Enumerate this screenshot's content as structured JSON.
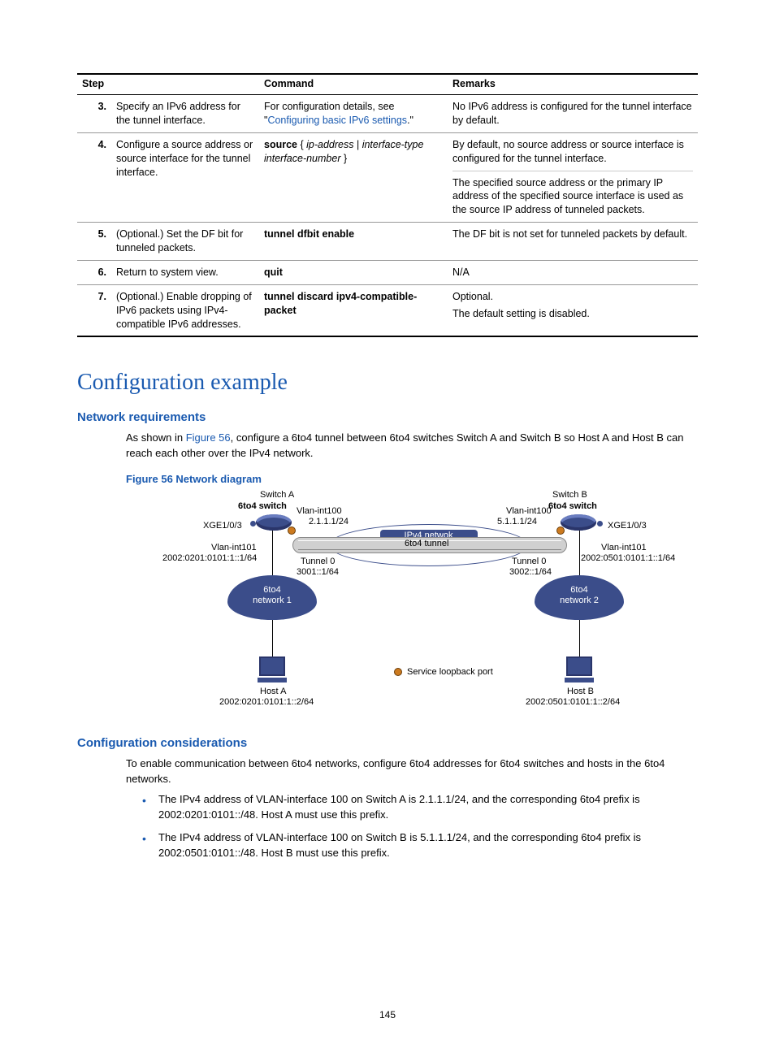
{
  "table": {
    "headers": {
      "step": "Step",
      "command": "Command",
      "remarks": "Remarks"
    },
    "rows": [
      {
        "num": "3.",
        "desc": "Specify an IPv6 address for the tunnel interface.",
        "cmd_pre": "For configuration details, see \"",
        "cmd_link": "Configuring basic IPv6 settings",
        "cmd_post": ".\"",
        "remarks": [
          "No IPv6 address is configured for the tunnel interface by default."
        ]
      },
      {
        "num": "4.",
        "desc": "Configure a source address or source interface for the tunnel interface.",
        "cmd_b1": "source",
        "cmd_i1": "ip-address",
        "cmd_sep": " { ",
        "cmd_mid": " | ",
        "cmd_i2": "interface-type interface-number",
        "cmd_end": " }",
        "remarks": [
          "By default, no source address or source interface is configured for the tunnel interface.",
          "The specified source address or the primary IP address of the specified source interface is used as the source IP address of tunneled packets."
        ]
      },
      {
        "num": "5.",
        "desc": "(Optional.) Set the DF bit for tunneled packets.",
        "cmd_b1": "tunnel dfbit enable",
        "remarks": [
          "The DF bit is not set for tunneled packets by default."
        ]
      },
      {
        "num": "6.",
        "desc": "Return to system view.",
        "cmd_b1": "quit",
        "remarks": [
          "N/A"
        ]
      },
      {
        "num": "7.",
        "desc": "(Optional.) Enable dropping of IPv6 packets using IPv4-compatible IPv6 addresses.",
        "cmd_b1": "tunnel discard ipv4-compatible-packet",
        "remarks": [
          "Optional.",
          "The default setting is disabled."
        ]
      }
    ]
  },
  "section_title": "Configuration example",
  "netreq": {
    "heading": "Network requirements",
    "pre": "As shown in ",
    "link": "Figure 56",
    "post": ", configure a 6to4 tunnel between 6to4 switches Switch A and Switch B so Host A and Host B can reach each other over the IPv4 network."
  },
  "figure": {
    "caption": "Figure 56 Network diagram",
    "labels": {
      "switchA": "Switch A",
      "switchB": "Switch B",
      "s6to4A": "6to4 switch",
      "s6to4B": "6to4 switch",
      "vlan100": "Vlan-int100",
      "ipA100": "2.1.1.1/24",
      "ipB100": "5.1.1.1/24",
      "ipv4": "IPv4 netwok",
      "tunLabel": "6to4 tunnel",
      "xgeA": "XGE1/0/3",
      "xgeB": "XGE1/0/3",
      "vlan101": "Vlan-int101",
      "addr101A": "2002:0201:0101:1::1/64",
      "addr101B": "2002:0501:0101:1::1/64",
      "tun0": "Tunnel 0",
      "tunA": "3001::1/64",
      "tunB": "3002::1/64",
      "cloud1_l1": "6to4",
      "cloud1_l2": "network 1",
      "cloud2_l1": "6to4",
      "cloud2_l2": "network 2",
      "hostA": "Host A",
      "hostAddrA": "2002:0201:0101:1::2/64",
      "hostB": "Host B",
      "hostAddrB": "2002:0501:0101:1::2/64",
      "legend": "Service loopback port"
    }
  },
  "confcons": {
    "heading": "Configuration considerations",
    "para": "To enable communication between 6to4 networks, configure 6to4 addresses for 6to4 switches and hosts in the 6to4 networks.",
    "bullets": [
      "The IPv4 address of VLAN-interface 100 on Switch A is 2.1.1.1/24, and the corresponding 6to4 prefix is 2002:0201:0101::/48. Host A must use this prefix.",
      "The IPv4 address of VLAN-interface 100 on Switch B is 5.1.1.1/24, and the corresponding 6to4 prefix is 2002:0501:0101::/48. Host B must use this prefix."
    ]
  },
  "page_number": "145"
}
